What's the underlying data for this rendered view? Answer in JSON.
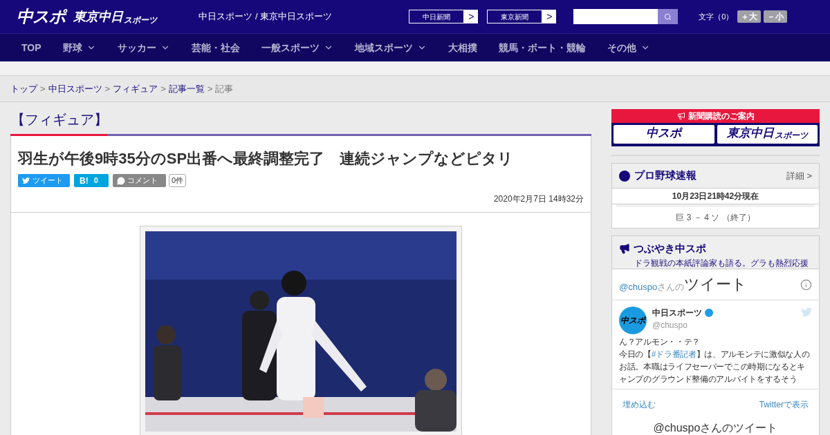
{
  "header": {
    "logo_main": "中スポ",
    "logo_sub": "東京中日",
    "logo_sub_small": "スポーツ",
    "site_title": "中日スポーツ / 東京中日スポーツ",
    "paper_links": [
      {
        "label": "中日新聞",
        "arrow": ">"
      },
      {
        "label": "東京新聞",
        "arrow": ">"
      }
    ],
    "font_size": {
      "label": "文字（0）",
      "buttons": [
        "＋大",
        "－小"
      ]
    }
  },
  "nav": [
    {
      "label": "TOP",
      "has_menu": false
    },
    {
      "label": "野球",
      "has_menu": true
    },
    {
      "label": "サッカー",
      "has_menu": true
    },
    {
      "label": "芸能・社会",
      "has_menu": false
    },
    {
      "label": "一般スポーツ",
      "has_menu": true
    },
    {
      "label": "地域スポーツ",
      "has_menu": true
    },
    {
      "label": "大相撲",
      "has_menu": false
    },
    {
      "label": "競馬・ボート・競輪",
      "has_menu": false
    },
    {
      "label": "その他",
      "has_menu": true
    }
  ],
  "breadcrumb": [
    {
      "label": "トップ",
      "link": true
    },
    {
      "label": "中日スポーツ",
      "link": true
    },
    {
      "label": "フィギュア",
      "link": true
    },
    {
      "label": "記事一覧",
      "link": true
    },
    {
      "label": "記事",
      "link": false
    }
  ],
  "breadcrumb_separator": ">",
  "article": {
    "category": "【フィギュア】",
    "title": "羽生が午後9時35分のSP出番へ最終調整完了　連続ジャンプなどピタリ",
    "share": {
      "tweet": "ツイート",
      "hatena": "B!",
      "hatena_count": "0",
      "comment": "コメント",
      "comment_count": "0件"
    },
    "date": "2020年2月7日 14時32分"
  },
  "sidebar": {
    "subscribe": {
      "title": "新聞購読のご案内",
      "papers": [
        {
          "main": "中スポ"
        },
        {
          "main": "東京中日",
          "small": "スポーツ"
        }
      ]
    },
    "baseball": {
      "title": "プロ野球速報",
      "detail": "詳細 >",
      "timestamp": "10月23日21時42分現在",
      "games": [
        "巨 3 － 4 ソ （終了）"
      ]
    },
    "tweets": {
      "title": "つぶやき中スポ",
      "subtitle": "ドラ観戦の本紙評論家も語る。グラも熱烈応援",
      "handle": "@chuspo",
      "handle_suffix": "さんの",
      "heading": "ツイート",
      "author": "中日スポーツ",
      "author_handle": "@chuspo",
      "avatar": "中スポ",
      "body_first": "ん？アルモン・・テ？",
      "body_before": "今日の【",
      "hashtag": "#ドラ番記者",
      "body_after": "】は、アルモンテに激似な人のお話。本職はライフセーバーでこの時期になるとキャンプのグラウンド整備のアルバイトをするそう",
      "embed": "埋め込む",
      "view_on": "Twitterで表示",
      "footer": "@chuspoさんのツイート"
    }
  }
}
